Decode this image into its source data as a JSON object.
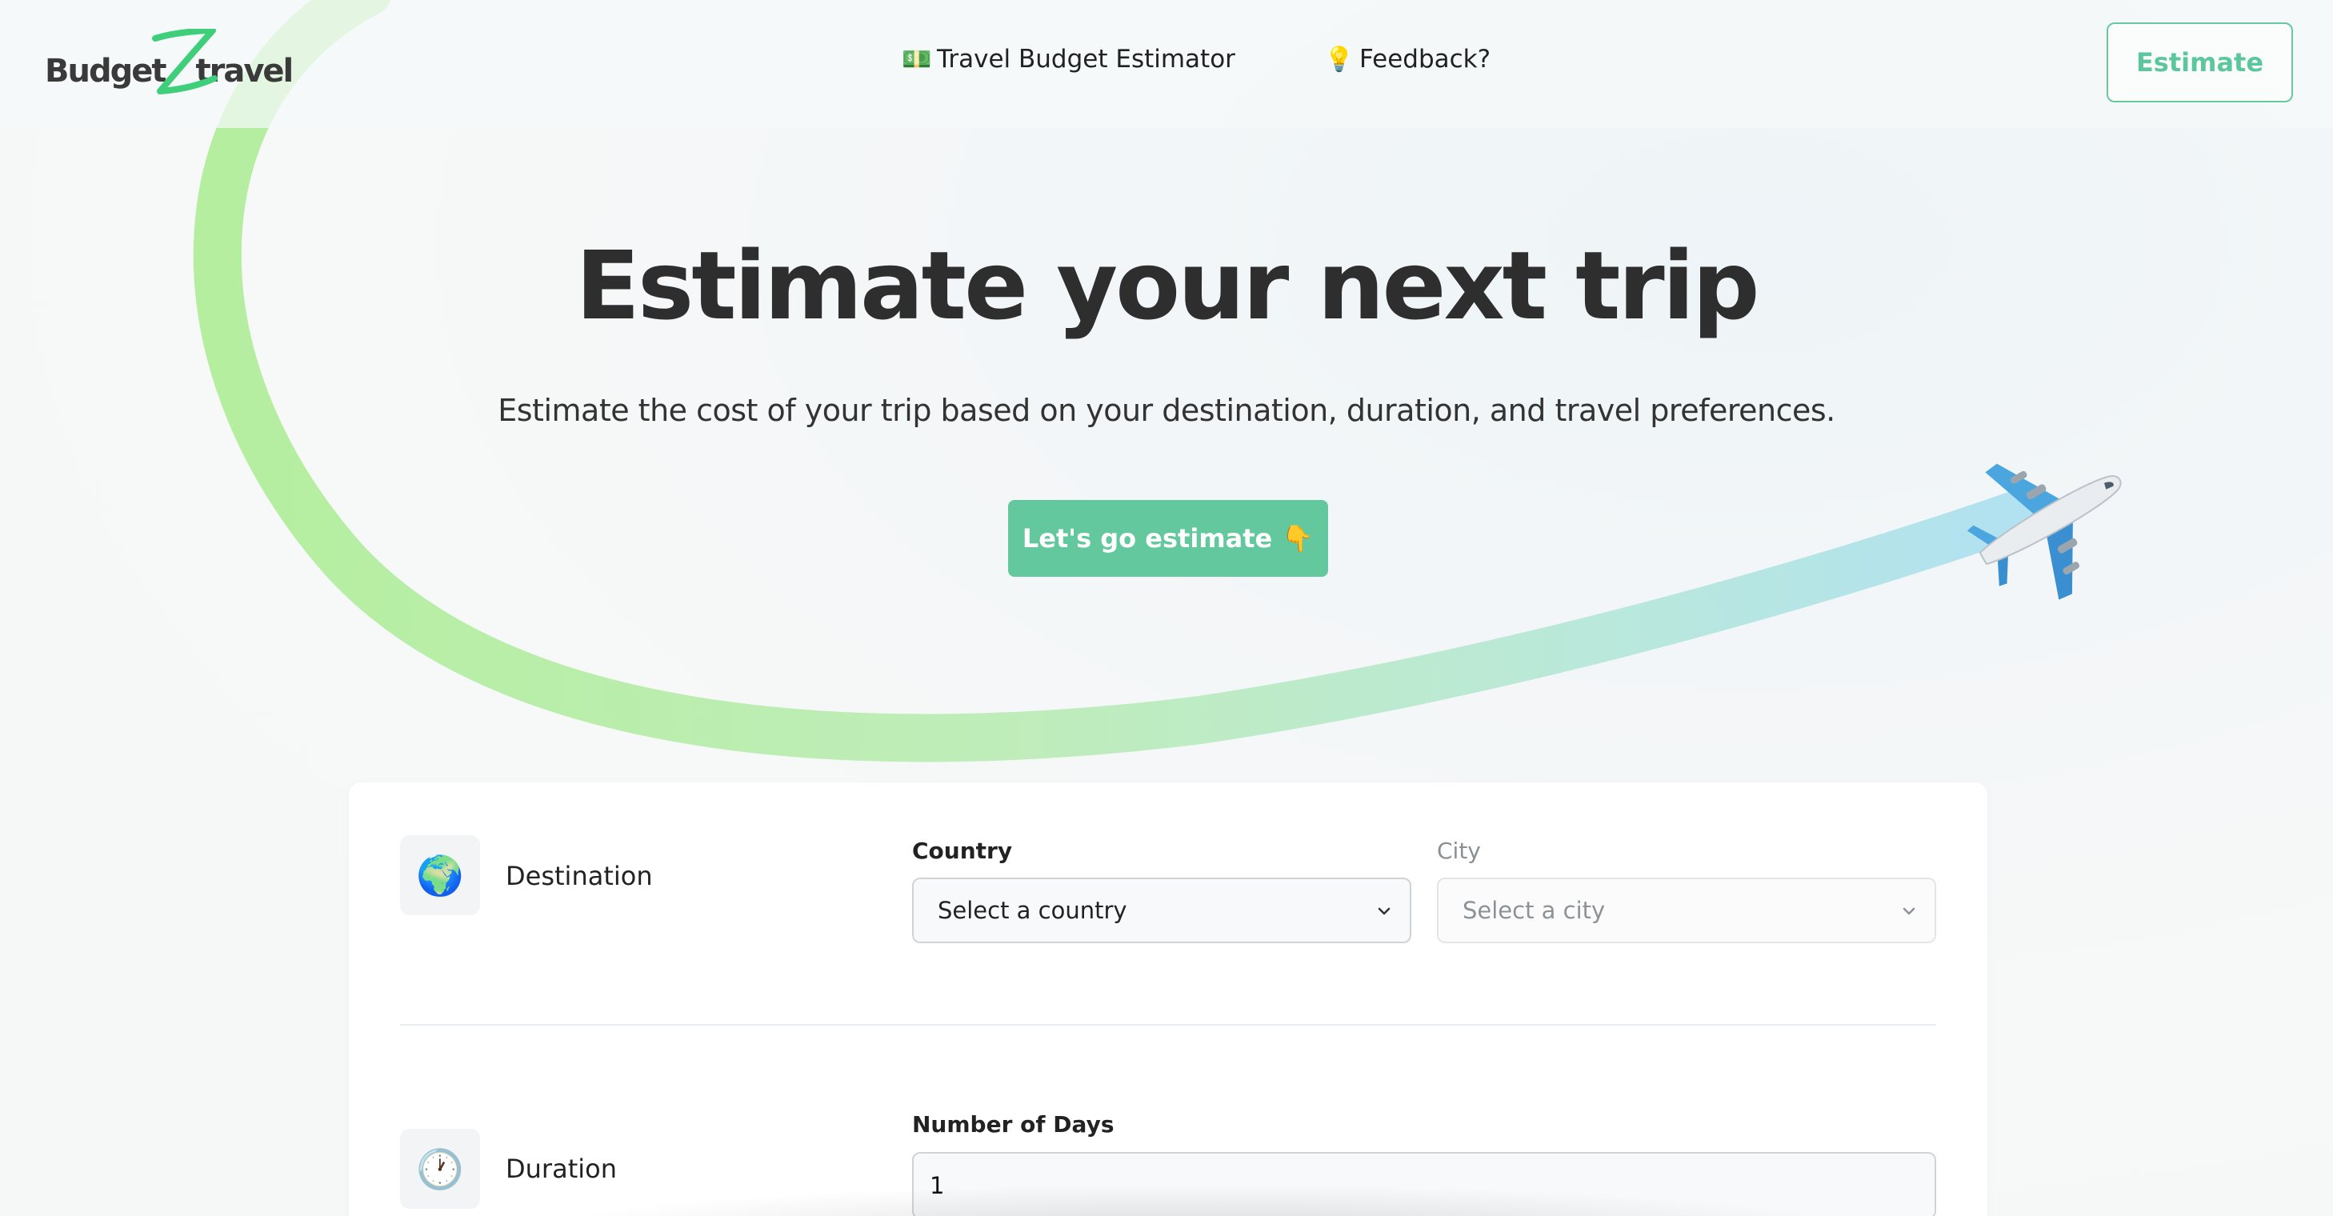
{
  "header": {
    "logo_left": "Budget",
    "logo_right": "travel",
    "nav_budget": {
      "icon": "banknote-icon",
      "glyph": "💵",
      "label": "Travel Budget Estimator"
    },
    "nav_feedback": {
      "icon": "lightbulb-icon",
      "glyph": "💡",
      "label": "Feedback?"
    },
    "estimate_button": "Estimate"
  },
  "hero": {
    "title": "Estimate your next trip",
    "subtitle": "Estimate the cost of your trip based on your destination, duration, and travel preferences.",
    "cta_label": "Let's go estimate",
    "cta_icon": "👇"
  },
  "form": {
    "destination": {
      "icon_glyph": "🌍",
      "label": "Destination",
      "country_label": "Country",
      "country_value": "Select a country",
      "city_label": "City",
      "city_value": "Select a city"
    },
    "duration": {
      "icon_glyph": "🕐",
      "label": "Duration",
      "days_label": "Number of Days",
      "days_value": "1"
    }
  },
  "colors": {
    "accent": "#64c89e",
    "trail_start": "#a9ec8f",
    "trail_end": "#a6def0",
    "text_dark": "#2e2e2e"
  }
}
